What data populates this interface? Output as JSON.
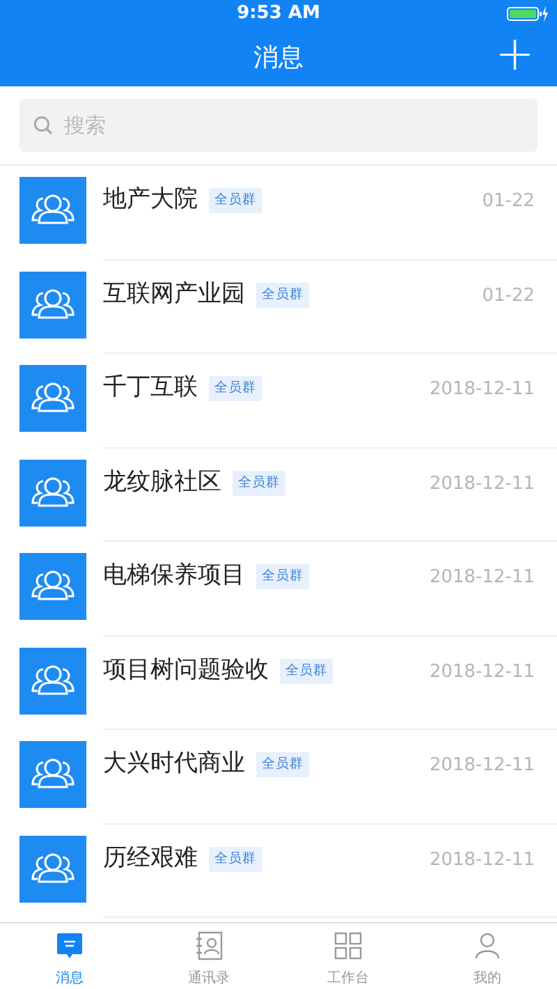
{
  "status_bar": {
    "time": "9:53 AM"
  },
  "header": {
    "title": "消息",
    "add_button": "+"
  },
  "search": {
    "placeholder": "搜索"
  },
  "conversations": [
    {
      "name": "地产大院",
      "tag": "全员群",
      "date": "01-22"
    },
    {
      "name": "互联网产业园",
      "tag": "全员群",
      "date": "01-22"
    },
    {
      "name": "千丁互联",
      "tag": "全员群",
      "date": "2018-12-11"
    },
    {
      "name": "龙纹脉社区",
      "tag": "全员群",
      "date": "2018-12-11"
    },
    {
      "name": "电梯保养项目",
      "tag": "全员群",
      "date": "2018-12-11"
    },
    {
      "name": "项目树问题验收",
      "tag": "全员群",
      "date": "2018-12-11"
    },
    {
      "name": "大兴时代商业",
      "tag": "全员群",
      "date": "2018-12-11"
    },
    {
      "name": "历经艰难",
      "tag": "全员群",
      "date": "2018-12-11"
    }
  ],
  "tab_bar": [
    {
      "label": "消息",
      "kind": "chat",
      "selected": true
    },
    {
      "label": "通讯录",
      "kind": "contacts",
      "selected": false
    },
    {
      "label": "工作台",
      "kind": "work",
      "selected": false
    },
    {
      "label": "我的",
      "kind": "me",
      "selected": false
    }
  ]
}
